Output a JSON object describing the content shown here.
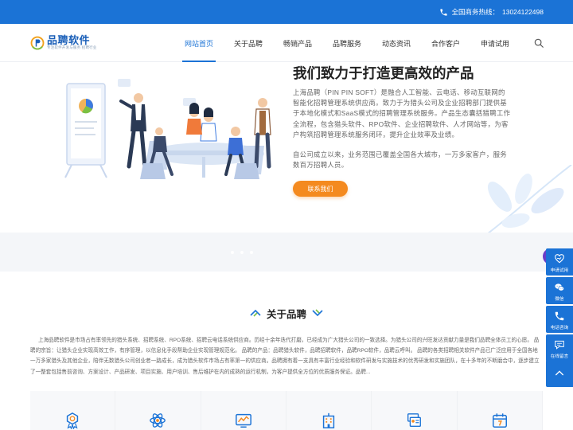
{
  "topbar": {
    "hotline_label": "全国商务热线：",
    "hotline_number": "13024122498",
    "icon": "phone-icon"
  },
  "logo": {
    "name": "品聘软件",
    "slogan": "专注软件开发与服务 招聘行业"
  },
  "nav": {
    "items": [
      {
        "label": "网站首页",
        "active": true
      },
      {
        "label": "关于品聘"
      },
      {
        "label": "畅销产品"
      },
      {
        "label": "品聘服务"
      },
      {
        "label": "动态资讯"
      },
      {
        "label": "合作客户"
      },
      {
        "label": "申请试用"
      }
    ],
    "search_icon": "search-icon"
  },
  "hero": {
    "title": "我们致力于打造更高效的产品",
    "paragraph1": "上海品聘（PIN PIN SOFT）是融合人工智能、云电话、移动互联网的智能化招聘管理系统供应商。致力于为猎头公司及企业招聘部门提供基于本地化模式和SaaS模式的招聘管理系统服务。产品生态囊括猎聘工作全流程，包含猎头软件、RPO软件、企业招聘软件、人才网站等，为客户构筑招聘管理系统服务闭环，提升企业效率及业绩。",
    "paragraph2": "自公司成立以来，业务范围已覆盖全国各大城市，一万多家客户，服务数百万招聘人员。",
    "button": "联系我们"
  },
  "about": {
    "title": "关于品聘",
    "text": "上海品聘软件是市场占有率领先的猎头系统、招聘系统、RPO系统、招聘云电话系统供应商。历经十余年迭代打磨，已经成为广大猎头公司的一致选择。为猎头公司的兴旺发达贡献力量是我们品聘全体员工的心愿。 品聘的宗旨：让猎头企业实现高效工作，有序管理，以信息化手段帮助企业实现管理规范化。 品聘的产品：品聘猎头软件，品聘招聘软件，品聘RPO软件，品聘云呼叫。 品聘的各类招聘相关软件产品已广泛应用于全国各地一万多家猎头及其他企业，陪伴无数猎头公司创业者一路成长，成为猎头软件市场占有率第一的供应商。品聘拥有着一支具有丰富行业经验和软件研发与实施技术的优秀研发和实施团队，在十多年的不断磨合中，逐步建立了一整套包括售前咨询、方案设计、产品研发、项目实施、用户培训、售后维护在内的成熟的运行机制，为客户提供全方位的优质服务保证。品聘..."
  },
  "cards": [
    {
      "icon": "award-icon"
    },
    {
      "icon": "atom-icon"
    },
    {
      "icon": "chart-monitor-icon"
    },
    {
      "icon": "building-icon"
    },
    {
      "icon": "id-cards-icon"
    },
    {
      "icon": "calendar-icon"
    }
  ],
  "float_bar": {
    "items": [
      {
        "label": "申请试用",
        "icon": "heart-hand-icon"
      },
      {
        "label": "微信",
        "icon": "wechat-icon"
      },
      {
        "label": "电话咨询",
        "icon": "phone-icon"
      },
      {
        "label": "在线留言",
        "icon": "message-icon"
      }
    ],
    "top_icon": "chevron-up-icon"
  },
  "colors": {
    "primary": "#1b73d6",
    "accent": "#f48a1f",
    "purple": "#6a3dc8"
  }
}
